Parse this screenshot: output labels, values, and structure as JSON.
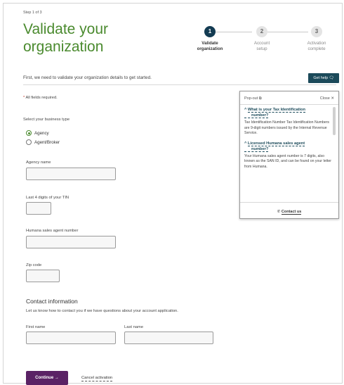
{
  "header": {
    "step_label": "Step 1 of 3",
    "title": "Validate your organization"
  },
  "stepper": [
    {
      "number": "1",
      "label_line1": "Validate",
      "label_line2": "organization",
      "active": true
    },
    {
      "number": "2",
      "label_line1": "Account",
      "label_line2": "setup",
      "active": false
    },
    {
      "number": "3",
      "label_line1": "Activation",
      "label_line2": "complete",
      "active": false
    }
  ],
  "intro": "First, we need to validate your organization details to get started.",
  "get_help": {
    "label": "Get help",
    "icon": "help-chat-icon"
  },
  "required_note": {
    "star": "*",
    "text": " All fields required."
  },
  "business_type": {
    "label": "Select your business type",
    "options": [
      {
        "label": "Agency",
        "checked": true
      },
      {
        "label": "Agent/Broker",
        "checked": false
      }
    ]
  },
  "fields": {
    "agency_name": {
      "label": "Agency name",
      "value": ""
    },
    "tin_last4": {
      "label": "Last 4 digits of your TIN",
      "value": ""
    },
    "sales_agent_number": {
      "label": "Humana sales agent number",
      "value": ""
    },
    "zip_code": {
      "label": "Zip code",
      "value": ""
    },
    "first_name": {
      "label": "First name",
      "value": ""
    },
    "last_name": {
      "label": "Last name",
      "value": ""
    }
  },
  "contact": {
    "title": "Contact information",
    "subtitle": "Let us know how to contact you if we have questions about your account application."
  },
  "actions": {
    "continue": "Continue  →",
    "cancel": "Cancel activation"
  },
  "help_panel": {
    "popout": "Pop-out ⧉",
    "close": "Close ✕",
    "items": [
      {
        "question_line1": "What is your Tax Identification",
        "question_line2": "number?",
        "answer": "Tax Identification Number Tax Identification Numbers are 9-digit numbers issued by the Internal Revenue Service."
      },
      {
        "question_line1": "Licensed Humana sales agent",
        "question_line2": "number?",
        "answer": "Your Humana sales agent number is 7 digits, also known as the SAN ID, and can be found on your letter from Humana."
      }
    ],
    "contact_label": "Contact us",
    "colors": {
      "link": "#1b4a5a"
    }
  },
  "colors": {
    "title_green": "#4a8a2e",
    "step_active": "#133b52",
    "help_button": "#1b4a5a",
    "continue_button": "#5a2265"
  }
}
